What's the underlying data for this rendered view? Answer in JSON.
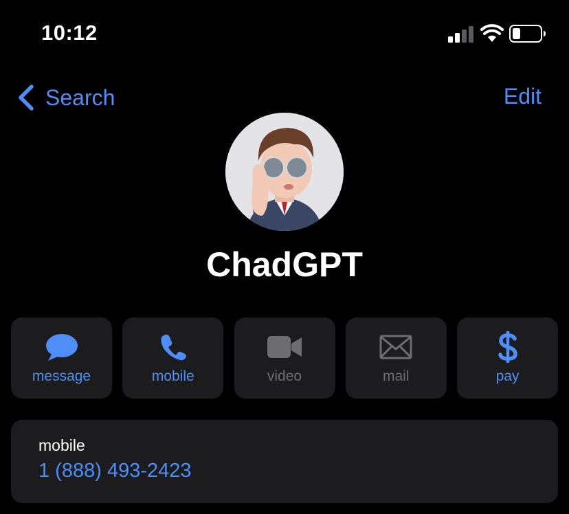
{
  "status_bar": {
    "time": "10:12",
    "icons": [
      "cellular-signal-icon",
      "wifi-icon",
      "battery-icon"
    ]
  },
  "nav": {
    "back_label": "Search",
    "edit_label": "Edit"
  },
  "contact": {
    "name": "ChadGPT",
    "avatar": "memoji-avatar"
  },
  "actions": [
    {
      "label": "message",
      "icon": "message-bubble-icon",
      "enabled": true
    },
    {
      "label": "mobile",
      "icon": "phone-icon",
      "enabled": true
    },
    {
      "label": "video",
      "icon": "video-camera-icon",
      "enabled": false
    },
    {
      "label": "mail",
      "icon": "envelope-icon",
      "enabled": false
    },
    {
      "label": "pay",
      "icon": "dollar-icon",
      "enabled": true
    }
  ],
  "phone": {
    "type": "mobile",
    "number": "1 (888) 493-2423"
  },
  "colors": {
    "background": "#000000",
    "accent": "#4f8ef7",
    "card": "#1c1c1e",
    "disabled": "#6d6d72"
  }
}
